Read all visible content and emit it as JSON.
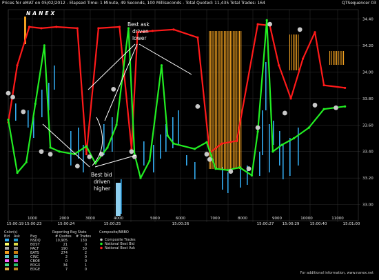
{
  "window": {
    "title": "Prices for  eMAT  on  05/02/2012  -  Elapsed Time: 1 Minute, 49 Seconds, 100 Milliseconds  -  Total Quoted: 11,435  Total Trades: 164",
    "sequencer": "QTSequencer 03"
  },
  "logo": "NANEX",
  "annotations": {
    "ask": [
      "Best ask",
      "driven",
      "lower"
    ],
    "bid": [
      "Best bid",
      "driven",
      "higher"
    ]
  },
  "colors": {
    "ask": "#ff1a1a",
    "bid": "#22ee22",
    "trade": "#c8c8c8",
    "bats": "#f0a020",
    "nsdq": "#33aaee",
    "grid": "#2a2a2a"
  },
  "legend": {
    "header": [
      "Color(s)",
      "Bid",
      "Ask",
      "Exg",
      "Reporting Exg Stats",
      "# Quotes",
      "# Trades",
      "Composite/NBBO"
    ],
    "rows": [
      {
        "exg": "NSDQ",
        "quotes": "10,905",
        "trades": "130",
        "bid": "#33aaee",
        "ask": "#2299cc"
      },
      {
        "exg": "BOST",
        "quotes": "21",
        "trades": "0",
        "bid": "#ffff66",
        "ask": "#dddd44"
      },
      {
        "exg": "PACF",
        "quotes": "190",
        "trades": "30",
        "bid": "#aaaaaa",
        "ask": "#888888"
      },
      {
        "exg": "BATS",
        "quotes": "274",
        "trades": "2",
        "bid": "#f0a020",
        "ask": "#cc8010"
      },
      {
        "exg": "CINC",
        "quotes": "2",
        "trades": "0",
        "bid": "#66cccc",
        "ask": "#44aaaa"
      },
      {
        "exg": "CBOE",
        "quotes": "0",
        "trades": "0",
        "bid": "#ff66ff",
        "ask": "#cc44cc"
      },
      {
        "exg": "EDGX",
        "quotes": "34",
        "trades": "1",
        "bid": "#44dd88",
        "ask": "#22bb66"
      },
      {
        "exg": "EDGE",
        "quotes": "7",
        "trades": "0",
        "bid": "#ddaa44",
        "ask": "#bb8822"
      }
    ],
    "composite": [
      "Composite Trades",
      "National Best Bid",
      "National Best Ask"
    ]
  },
  "footer": "For additional information, www.nanex.net",
  "chart_data": {
    "type": "line",
    "y_ticks": [
      "34.40",
      "34.20",
      "34.00",
      "33.80",
      "33.60",
      "33.40",
      "33.20",
      "33.00"
    ],
    "ylim": [
      32.92,
      34.47
    ],
    "x_ticks_top": [
      "1000",
      "2000",
      "3000",
      "4000",
      "5000",
      "6000",
      "7000",
      "8000",
      "9000",
      "10000",
      "11000"
    ],
    "x_ticks_bottom": [
      "15:00:19",
      "15:00:23",
      "15:00:24",
      "15:00:25",
      "15:00:26",
      "15:00:27",
      "15:00:29",
      "15:00:40",
      "15:01:00"
    ],
    "series": [
      {
        "name": "National Best Ask",
        "values": [
          [
            0,
            33.62
          ],
          [
            300,
            34.05
          ],
          [
            700,
            34.34
          ],
          [
            1100,
            34.33
          ],
          [
            1600,
            34.34
          ],
          [
            2300,
            34.33
          ],
          [
            2600,
            33.38
          ],
          [
            3000,
            34.33
          ],
          [
            3700,
            34.34
          ],
          [
            4100,
            33.42
          ],
          [
            4300,
            34.3
          ],
          [
            4800,
            34.31
          ],
          [
            5500,
            34.32
          ],
          [
            6300,
            34.26
          ],
          [
            6700,
            33.39
          ],
          [
            7100,
            33.46
          ],
          [
            7600,
            33.48
          ],
          [
            8300,
            34.36
          ],
          [
            8700,
            34.35
          ],
          [
            9000,
            34.05
          ],
          [
            9400,
            33.8
          ],
          [
            9800,
            34.1
          ],
          [
            10200,
            34.3
          ],
          [
            10500,
            33.9
          ],
          [
            11200,
            33.88
          ]
        ]
      },
      {
        "name": "National Best Bid",
        "values": [
          [
            0,
            33.64
          ],
          [
            300,
            33.24
          ],
          [
            600,
            33.32
          ],
          [
            900,
            33.76
          ],
          [
            1200,
            34.2
          ],
          [
            1400,
            33.43
          ],
          [
            1700,
            33.4
          ],
          [
            2200,
            33.38
          ],
          [
            2600,
            33.44
          ],
          [
            2900,
            33.31
          ],
          [
            3300,
            33.43
          ],
          [
            3600,
            33.6
          ],
          [
            4000,
            34.33
          ],
          [
            4200,
            33.38
          ],
          [
            4400,
            33.2
          ],
          [
            4700,
            33.33
          ],
          [
            5100,
            34.05
          ],
          [
            5300,
            33.52
          ],
          [
            5500,
            33.46
          ],
          [
            6200,
            33.42
          ],
          [
            6600,
            33.47
          ],
          [
            6900,
            33.27
          ],
          [
            7300,
            33.26
          ],
          [
            7700,
            33.28
          ],
          [
            8100,
            33.22
          ],
          [
            8300,
            33.55
          ],
          [
            8600,
            34.39
          ],
          [
            8800,
            33.4
          ],
          [
            9100,
            33.45
          ],
          [
            9500,
            33.5
          ],
          [
            10000,
            33.58
          ],
          [
            10500,
            33.72
          ],
          [
            11200,
            33.74
          ]
        ]
      },
      {
        "name": "Composite Trades",
        "values": [
          [
            0,
            33.84
          ],
          [
            150,
            33.81
          ],
          [
            500,
            33.7
          ],
          [
            1100,
            33.4
          ],
          [
            1400,
            33.38
          ],
          [
            2300,
            33.29
          ],
          [
            2700,
            33.36
          ],
          [
            3100,
            33.38
          ],
          [
            3500,
            33.87
          ],
          [
            4100,
            33.4
          ],
          [
            4200,
            33.36
          ],
          [
            6300,
            33.74
          ],
          [
            6600,
            33.38
          ],
          [
            6700,
            33.34
          ],
          [
            7400,
            33.25
          ],
          [
            8000,
            33.27
          ],
          [
            8300,
            33.58
          ],
          [
            8700,
            34.36
          ],
          [
            9200,
            33.69
          ],
          [
            9700,
            34.32
          ],
          [
            10200,
            33.75
          ],
          [
            10900,
            33.73
          ]
        ]
      }
    ]
  }
}
